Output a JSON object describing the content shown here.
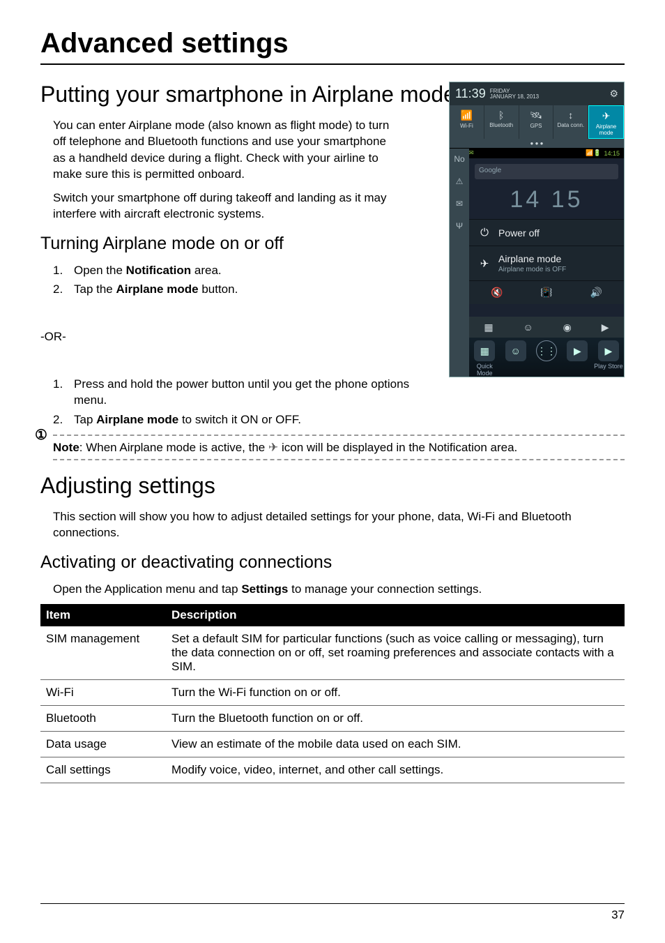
{
  "page_title": "Advanced settings",
  "section1": {
    "heading": "Putting your smartphone in Airplane mode",
    "para1": "You can enter Airplane mode (also known as flight mode) to turn off telephone and Bluetooth functions and use your smartphone as a handheld device during a flight. Check with your airline to make sure this is permitted onboard.",
    "para2": "Switch your smartphone off during takeoff and landing as it may interfere with aircraft electronic systems.",
    "subheading": "Turning Airplane mode on or off",
    "steps1": {
      "s1_a": "Open the ",
      "s1_b": "Notification",
      "s1_c": " area.",
      "s2_a": "Tap the ",
      "s2_b": "Airplane mode",
      "s2_c": " button."
    },
    "or": "-OR-",
    "steps2": {
      "s1_a": "Press and hold the power button until you get the phone options menu.",
      "s2_a": "Tap ",
      "s2_b": "Airplane mode",
      "s2_c": " to switch it ON or OFF."
    },
    "note_a": "Note",
    "note_b": ": When Airplane mode is active, the ",
    "note_c": " icon will be displayed in the Notification area."
  },
  "section2": {
    "heading": "Adjusting settings",
    "para1": "This section will show you how to adjust detailed settings for your phone, data, Wi-Fi and Bluetooth connections.",
    "subheading": "Activating or deactivating connections",
    "para2_a": "Open the Application menu and tap ",
    "para2_b": "Settings",
    "para2_c": " to manage your connection settings."
  },
  "table": {
    "header_item": "Item",
    "header_desc": "Description",
    "rows": [
      {
        "item": "SIM management",
        "desc": "Set a default SIM for particular functions (such as voice calling or messaging), turn the data connection on or off, set roaming preferences and associate contacts with a SIM."
      },
      {
        "item": "Wi-Fi",
        "desc": "Turn the Wi-Fi function on or off."
      },
      {
        "item": "Bluetooth",
        "desc": "Turn the Bluetooth function on or off."
      },
      {
        "item": "Data usage",
        "desc": "View an estimate of the mobile data used on each SIM."
      },
      {
        "item": "Call settings",
        "desc": "Modify voice, video, internet, and other call settings."
      }
    ]
  },
  "screenshot": {
    "time": "11:39",
    "day": "FRIDAY",
    "date": "JANUARY 18, 2013",
    "toggles": [
      "Wi-Fi",
      "Bluetooth",
      "GPS",
      "Data conn.",
      "Airplane mode"
    ],
    "status_left": "No",
    "status_time": "14:15",
    "search": "Google",
    "clock": "14 15",
    "menu_poweroff": "Power off",
    "menu_airplane": "Airplane mode",
    "menu_airplane_sub": "Airplane mode is OFF",
    "dock_left": "Quick Mode",
    "dock_right": "Play Store"
  },
  "page_number": "37"
}
